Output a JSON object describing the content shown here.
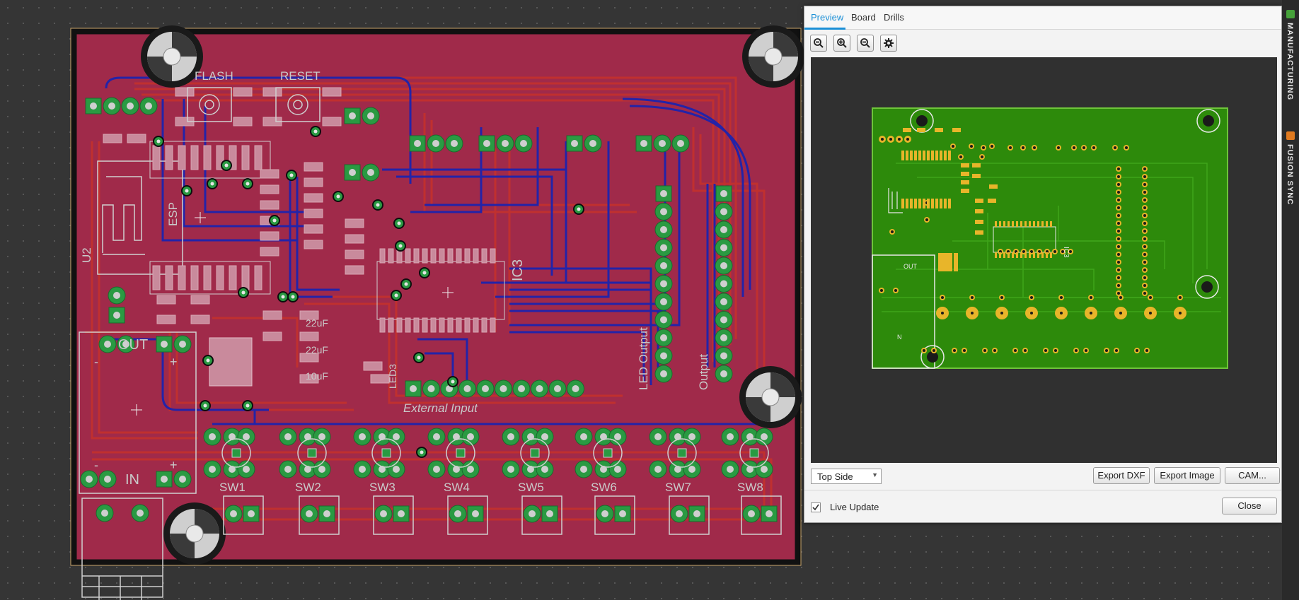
{
  "board_labels": {
    "flash": "FLASH",
    "reset": "RESET",
    "u2": "U2",
    "esp": "ESP",
    "ic3": "IC3",
    "led3": "LED3",
    "led_output": "LED Output",
    "output": "Output",
    "out": "OUT",
    "in": "IN",
    "external_input": "External Input",
    "cap1": "22uF",
    "cap2": "22uF",
    "cap3": "10uF",
    "plus": "+",
    "minus": "-",
    "switches": [
      "SW1",
      "SW2",
      "SW3",
      "SW4",
      "SW5",
      "SW6",
      "SW7",
      "SW8"
    ]
  },
  "preview_panel": {
    "tabs": [
      "Preview",
      "Board",
      "Drills"
    ],
    "active_tab": "Preview",
    "side_select": "Top Side",
    "buttons": {
      "export_dxf": "Export DXF",
      "export_image": "Export Image",
      "cam": "CAM...",
      "close": "Close"
    },
    "live_update_label": "Live Update",
    "live_update_checked": true,
    "preview_labels": {
      "ic3": "IC3",
      "out": "OUT",
      "n": "N"
    }
  },
  "sidebar": {
    "manufacturing": "MANUFACTURING",
    "fusion_sync": "FUSION SYNC"
  },
  "colors": {
    "board": "#a02a4a",
    "top_trace": "#b52a2f",
    "bottom_trace": "#2222aa",
    "pad": "#2a9a42",
    "preview_board": "#2d8a0b",
    "preview_pad": "#e8b52a",
    "accent": "#1b8fd6"
  },
  "icons": [
    "zoom-to-fit-icon",
    "zoom-in-icon",
    "zoom-out-icon",
    "settings-gear-icon",
    "checkbox-check-icon",
    "manufacturing-icon",
    "fusion-sync-icon"
  ]
}
